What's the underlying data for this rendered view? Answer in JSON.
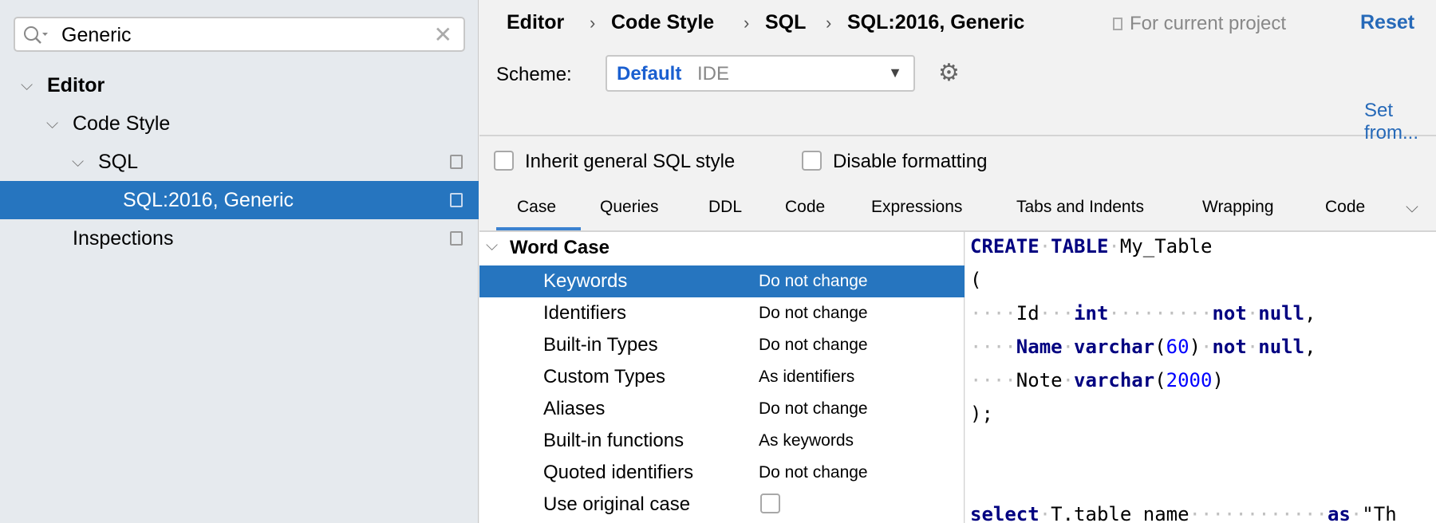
{
  "search": {
    "value": "Generic"
  },
  "tree": [
    {
      "label": "Editor"
    },
    {
      "label": "Code Style"
    },
    {
      "label": "SQL"
    },
    {
      "label": "SQL:2016, Generic"
    },
    {
      "label": "Inspections"
    }
  ],
  "breadcrumb": [
    "Editor",
    "Code Style",
    "SQL",
    "SQL:2016, Generic"
  ],
  "header": {
    "for_project": "For current project",
    "reset": "Reset",
    "scheme_label": "Scheme:",
    "scheme_name": "Default",
    "scheme_type": "IDE",
    "set_from": "Set from..."
  },
  "options": {
    "inherit": "Inherit general SQL style",
    "disable": "Disable formatting"
  },
  "tabs": [
    "Case",
    "Queries",
    "DDL",
    "Code",
    "Expressions",
    "Tabs and Indents",
    "Wrapping",
    "Code"
  ],
  "section": "Word Case",
  "rows": [
    {
      "k": "Keywords",
      "v": "Do not change"
    },
    {
      "k": "Identifiers",
      "v": "Do not change"
    },
    {
      "k": "Built-in Types",
      "v": "Do not change"
    },
    {
      "k": "Custom Types",
      "v": "As identifiers"
    },
    {
      "k": "Aliases",
      "v": "Do not change"
    },
    {
      "k": "Built-in functions",
      "v": "As keywords"
    },
    {
      "k": "Quoted identifiers",
      "v": "Do not change"
    },
    {
      "k": "Use original case",
      "v": ""
    }
  ],
  "code": [
    [
      [
        "CREATE",
        "kw"
      ],
      [
        "·",
        "ws"
      ],
      [
        "TABLE",
        "kw"
      ],
      [
        "·",
        "ws"
      ],
      [
        "My_Table",
        ""
      ]
    ],
    [
      [
        "(",
        ""
      ]
    ],
    [
      [
        "····",
        "ws"
      ],
      [
        "Id",
        ""
      ],
      [
        "···",
        "ws"
      ],
      [
        "int",
        "kw"
      ],
      [
        "·········",
        "ws"
      ],
      [
        "not",
        "kw"
      ],
      [
        "·",
        "ws"
      ],
      [
        "null",
        "kw"
      ],
      [
        ",",
        ""
      ]
    ],
    [
      [
        "····",
        "ws"
      ],
      [
        "Name",
        "kw"
      ],
      [
        "·",
        "ws"
      ],
      [
        "varchar",
        "kw"
      ],
      [
        "(",
        ""
      ],
      [
        "60",
        "num"
      ],
      [
        ")",
        ""
      ],
      [
        "·",
        "ws"
      ],
      [
        "not",
        "kw"
      ],
      [
        "·",
        "ws"
      ],
      [
        "null",
        "kw"
      ],
      [
        ",",
        ""
      ]
    ],
    [
      [
        "····",
        "ws"
      ],
      [
        "Note",
        ""
      ],
      [
        "·",
        "ws"
      ],
      [
        "varchar",
        "kw"
      ],
      [
        "(",
        ""
      ],
      [
        "2000",
        "num"
      ],
      [
        ")",
        ""
      ]
    ],
    [
      [
        ");",
        ""
      ]
    ],
    [],
    [],
    [
      [
        "select",
        "kw"
      ],
      [
        "·",
        "ws"
      ],
      [
        "T.table_name",
        ""
      ],
      [
        "············",
        "ws"
      ],
      [
        "as",
        "kw"
      ],
      [
        "·",
        "ws"
      ],
      [
        "\"Th",
        ""
      ]
    ]
  ],
  "colors": {
    "accent": "#2675bf",
    "link": "#2669b8",
    "keyword": "#000080",
    "number": "#0000ff"
  }
}
